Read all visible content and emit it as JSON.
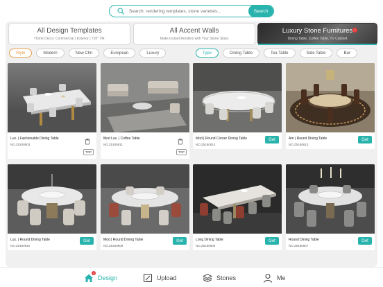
{
  "search": {
    "placeholder": "Search: rendering templates, stone varieties...",
    "button_label": "Search"
  },
  "categories": [
    {
      "title": "All Design Templates",
      "subtitle": "Home Deco | Commercial | Exterior | 720° VR"
    },
    {
      "title": "All Accent Walls",
      "subtitle": "Make instant Renders with Your Stone Slabs"
    },
    {
      "title": "Luxury Stone Furnitures",
      "subtitle": "Dining Table, Coffee Table, TV Cabinet",
      "badge": "1"
    }
  ],
  "style_filters": [
    "Style",
    "Modern",
    "New Chn",
    "European",
    "Luxury"
  ],
  "type_filters": [
    "Type",
    "Dining Table",
    "Tea Table",
    "Side Table",
    "Bar"
  ],
  "products": [
    {
      "name": "Lux. | Fashionable Dining Table",
      "code": "NO.Z5180803",
      "action": "trash",
      "tag": "TOP"
    },
    {
      "name": "Mod Lux. | Coffee Table",
      "code": "NO.Z5180811",
      "action": "trash",
      "tag": "TOP"
    },
    {
      "name": "Mod | Round Corner Dining Table",
      "code": "NO.Z5180813",
      "action": "Get"
    },
    {
      "name": "Am | Round Dining Table",
      "code": "NO.Z5180813",
      "action": "Get"
    },
    {
      "name": "Lux. | Round Dining Table",
      "code": "NO.Z5180810",
      "action": "Get"
    },
    {
      "name": "Mod | Round Dining Table",
      "code": "NO.Z5180809",
      "action": "Get"
    },
    {
      "name": "Long Dining Table",
      "code": "NO.Z5180808",
      "action": "Get"
    },
    {
      "name": "Round Dining Table",
      "code": "NO.Z5180807",
      "action": "Get"
    }
  ],
  "tabs": [
    {
      "label": "Design",
      "icon": "home-icon",
      "badge": "1"
    },
    {
      "label": "Upload",
      "icon": "upload-icon"
    },
    {
      "label": "Stones",
      "icon": "layers-icon"
    },
    {
      "label": "Me",
      "icon": "user-icon"
    }
  ],
  "colors": {
    "accent": "#29b3ad",
    "style_accent": "#e8943a",
    "badge": "#e63b3b"
  }
}
